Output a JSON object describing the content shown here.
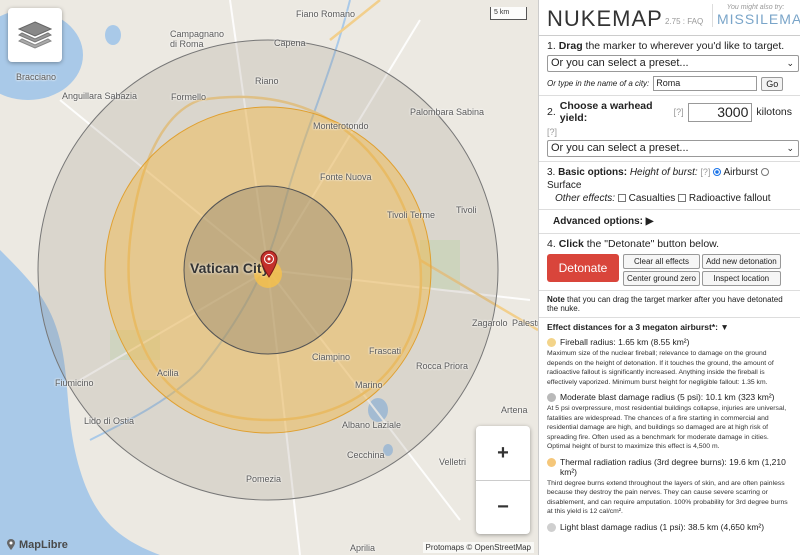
{
  "map": {
    "places": [
      {
        "id": "fiano",
        "name": "Fiano Romano"
      },
      {
        "id": "campagnano",
        "name": "Campagnano\ndi Roma"
      },
      {
        "id": "capena",
        "name": "Capena"
      },
      {
        "id": "bracciano",
        "name": "Bracciano"
      },
      {
        "id": "anguillara",
        "name": "Anguillara Sabazia"
      },
      {
        "id": "rignano",
        "name": "Riano"
      },
      {
        "id": "formello",
        "name": "Formello"
      },
      {
        "id": "palombara",
        "name": "Palombara Sabina"
      },
      {
        "id": "monterotondo",
        "name": "Monterotondo"
      },
      {
        "id": "fontenuova",
        "name": "Fonte Nuova"
      },
      {
        "id": "tivoliterme",
        "name": "Tivoli Terme"
      },
      {
        "id": "tivoli",
        "name": "Tivoli"
      },
      {
        "id": "zagarolo",
        "name": "Zagarolo"
      },
      {
        "id": "palestrina",
        "name": "Palestrina"
      },
      {
        "id": "ciampino",
        "name": "Ciampino"
      },
      {
        "id": "frascati",
        "name": "Frascati"
      },
      {
        "id": "roccapriora",
        "name": "Rocca Priora"
      },
      {
        "id": "fiumicino",
        "name": "Fiumicino"
      },
      {
        "id": "acilia",
        "name": "Acilia"
      },
      {
        "id": "marino",
        "name": "Marino"
      },
      {
        "id": "artena",
        "name": "Artena"
      },
      {
        "id": "lidodiostia",
        "name": "Lido di Ostia"
      },
      {
        "id": "albano",
        "name": "Albano Laziale"
      },
      {
        "id": "cecchina",
        "name": "Cecchina"
      },
      {
        "id": "velletri",
        "name": "Velletri"
      },
      {
        "id": "pomezia",
        "name": "Pomezia"
      },
      {
        "id": "aprilia",
        "name": "Aprilia"
      }
    ],
    "city_label": "Vatican City",
    "scale": "5 km",
    "zoom_in": "+",
    "zoom_out": "−",
    "maplibre": "MapLibre",
    "attribution": "Protomaps © OpenStreetMap"
  },
  "panel": {
    "title": "NUKEMAP",
    "version": "2.75 : FAQ",
    "also_try": "You might also try:",
    "also_link": "MISSILEMAP",
    "step1": {
      "num": "1.",
      "bold": "Drag",
      "rest": " the marker to wherever you'd like to target.",
      "preset": "Or you can select a preset...",
      "city_label": "Or type in the name of a city:",
      "city_value": "Roma",
      "go": "Go"
    },
    "step2": {
      "num": "2.",
      "bold": "Choose a warhead yield:",
      "q": "[?]",
      "yield": "3000",
      "unit": "kilotons",
      "q2": "[?]",
      "preset": "Or you can select a preset..."
    },
    "step3": {
      "num": "3.",
      "bold": "Basic options:",
      "hob": "Height of burst:",
      "q": "[?]",
      "airburst": "Airburst",
      "surface": "Surface",
      "other": "Other effects:",
      "casualties": "Casualties",
      "fallout": "Radioactive fallout"
    },
    "advanced": "Advanced options: ▶",
    "step4": {
      "num": "4.",
      "bold": "Click",
      "rest": " the \"Detonate\" button below.",
      "detonate": "Detonate",
      "clear": "Clear all effects",
      "add": "Add new detonation",
      "center": "Center ground zero",
      "inspect": "Inspect location"
    },
    "note": {
      "bold": "Note",
      "rest": " that you can drag the target marker after you have detonated the nuke."
    },
    "effects_head": "Effect distances for a 3 megaton airburst*: ▼",
    "effects": [
      {
        "title": "Fireball radius: 1.65 km (8.55 km²)",
        "color": "#f3d48a",
        "desc": "Maximum size of the nuclear fireball; relevance to damage on the ground depends on the height of detonation. If it touches the ground, the amount of radioactive fallout is significantly increased. Anything inside the fireball is effectively vaporized. Minimum burst height for negligible fallout: 1.35 km."
      },
      {
        "title": "Moderate blast damage radius (5 psi): 10.1 km (323 km²)",
        "color": "#b9b9b9",
        "desc": "At 5 psi overpressure, most residential buildings collapse, injuries are universal, fatalities are widespread. The chances of a fire starting in commercial and residential damage are high, and buildings so damaged are at high risk of spreading fire. Often used as a benchmark for moderate damage in cities. Optimal height of burst to maximize this effect is 4,500 m."
      },
      {
        "title": "Thermal radiation radius (3rd degree burns): 19.6 km (1,210 km²)",
        "color": "#f5c77a",
        "desc": "Third degree burns extend throughout the layers of skin, and are often painless because they destroy the pain nerves. They can cause severe scarring or disablement, and can require amputation. 100% probability for 3rd degree burns at this yield is 12 cal/cm²."
      },
      {
        "title": "Light blast damage radius (1 psi): 38.5 km (4,650 km²)",
        "color": "#cfcfcf",
        "desc": ""
      }
    ]
  }
}
